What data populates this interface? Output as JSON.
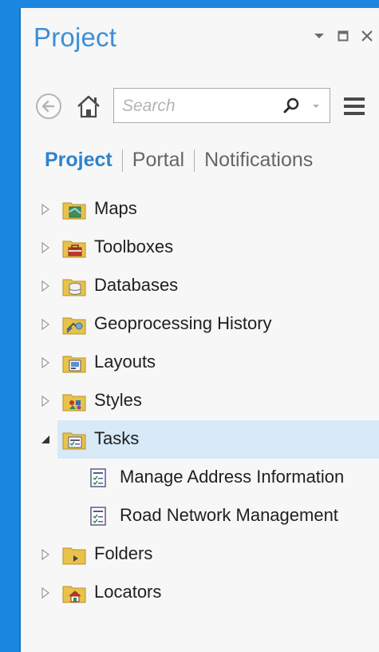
{
  "panel": {
    "title": "Project"
  },
  "window_controls": [
    {
      "name": "pin-dropdown",
      "icon": "chevron-down-icon"
    },
    {
      "name": "maximize",
      "icon": "maximize-icon"
    },
    {
      "name": "close",
      "icon": "close-icon"
    }
  ],
  "toolbar": {
    "back_icon": "back-arrow-icon",
    "home_icon": "home-icon",
    "search_placeholder": "Search",
    "menu_icon": "hamburger-menu-icon"
  },
  "tabs": [
    {
      "label": "Project",
      "active": true
    },
    {
      "label": "Portal",
      "active": false
    },
    {
      "label": "Notifications",
      "active": false
    }
  ],
  "tree": {
    "items": [
      {
        "label": "Maps",
        "icon": "maps-folder-icon",
        "expanded": false
      },
      {
        "label": "Toolboxes",
        "icon": "toolbox-folder-icon",
        "expanded": false
      },
      {
        "label": "Databases",
        "icon": "database-folder-icon",
        "expanded": false
      },
      {
        "label": "Geoprocessing History",
        "icon": "history-folder-icon",
        "expanded": false
      },
      {
        "label": "Layouts",
        "icon": "layout-folder-icon",
        "expanded": false
      },
      {
        "label": "Styles",
        "icon": "styles-folder-icon",
        "expanded": false
      },
      {
        "label": "Tasks",
        "icon": "tasks-folder-icon",
        "expanded": true,
        "selected": true,
        "children": [
          {
            "label": "Manage Address Information",
            "icon": "task-item-icon"
          },
          {
            "label": "Road Network Management",
            "icon": "task-item-icon"
          }
        ]
      },
      {
        "label": "Folders",
        "icon": "folders-folder-icon",
        "expanded": false
      },
      {
        "label": "Locators",
        "icon": "locator-folder-icon",
        "expanded": false
      }
    ]
  },
  "colors": {
    "frame_blue": "#1a86e0",
    "title_blue": "#3c8fd6",
    "active_tab": "#2d83cf",
    "selection": "#d8e9f7",
    "folder_yellow": "#e8c24a"
  }
}
